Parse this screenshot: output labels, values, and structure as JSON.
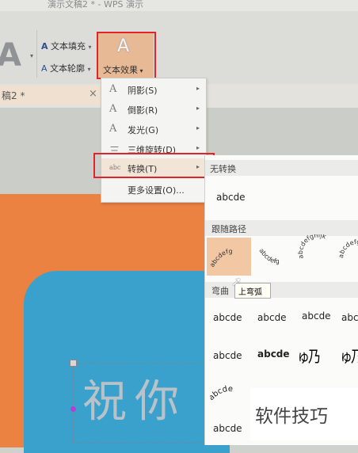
{
  "window": {
    "title": "演示文稿2 * - WPS 演示"
  },
  "ribbon": {
    "text_fill": "文本填充",
    "text_outline": "文本轮廓",
    "text_effect": "文本效果",
    "text_effect_glyph": "A",
    "big_glyph": "A"
  },
  "doc_tab": {
    "label": "稿2 *",
    "close": "×"
  },
  "menu": {
    "items": [
      {
        "label": "阴影(S)",
        "icon": "A",
        "has_arrow": true
      },
      {
        "label": "倒影(R)",
        "icon": "A",
        "has_arrow": true
      },
      {
        "label": "发光(G)",
        "icon": "A",
        "has_arrow": true
      },
      {
        "label": "三维旋转(D)",
        "icon": "三",
        "has_arrow": true
      },
      {
        "label": "转换(T)",
        "icon": "abc",
        "has_arrow": true
      },
      {
        "label": "更多设置(O)...",
        "icon": "",
        "has_arrow": false
      }
    ],
    "arrow": "▸"
  },
  "submenu": {
    "section_no_transform": "无转换",
    "plain_sample": "abcde",
    "section_follow_path": "跟随路径",
    "section_warp": "弯曲",
    "tooltip": "上弯弧",
    "warp_samples": [
      "abcde",
      "abcde",
      "abcde",
      "abc",
      "abcde",
      "abcde",
      "abcde",
      "abcde",
      "abcde"
    ]
  },
  "slide": {
    "text": "祝你"
  },
  "watermark": {
    "text": "软件技巧"
  },
  "colors": {
    "highlight": "#e0252a",
    "orange": "#ec8242",
    "blue": "#3aa1cc",
    "selected": "#f2c7a4"
  }
}
